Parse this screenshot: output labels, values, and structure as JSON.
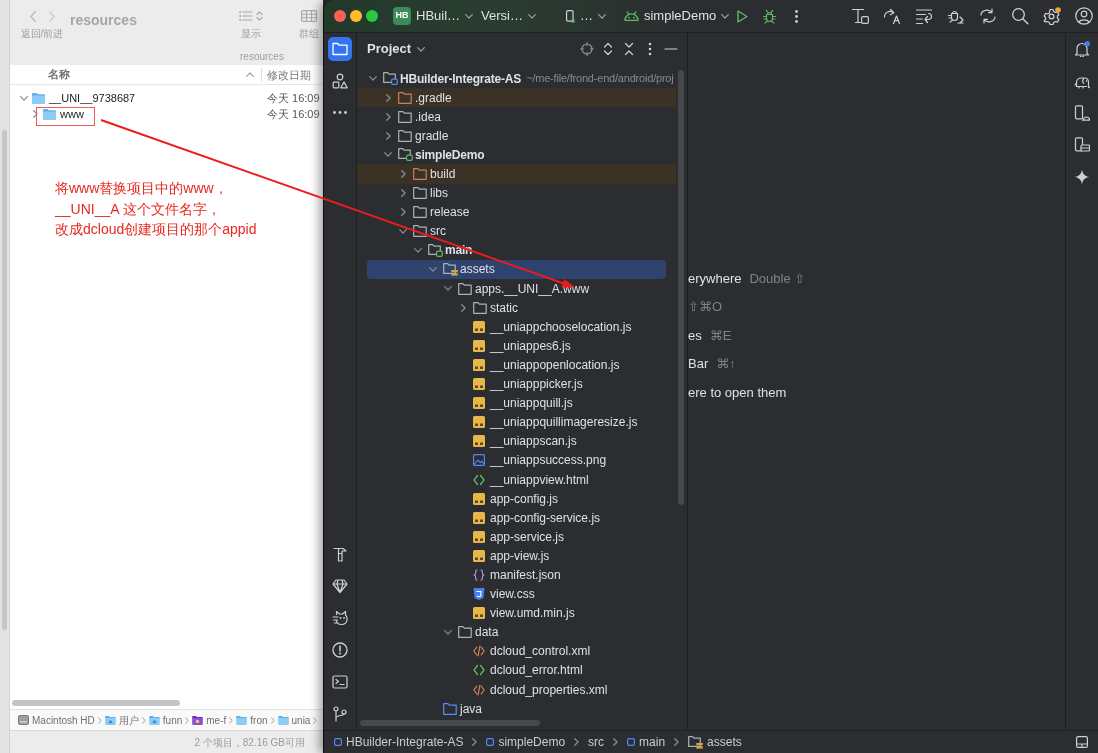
{
  "finder": {
    "title": "resources",
    "nav_label": "返回/前进",
    "view_label": "显示",
    "group_label": "群组",
    "subtitle": "resources",
    "columns": [
      "名称",
      "修改日期"
    ],
    "rows": [
      {
        "name": "__UNI__9738687",
        "modified": "今天 16:09",
        "expanded": true,
        "selected": false,
        "marked": false,
        "children": [
          {
            "name": "www",
            "modified": "今天 16:09",
            "expanded": false,
            "selected": false,
            "marked": true
          }
        ]
      }
    ],
    "path": [
      {
        "kind": "disk",
        "label": "Macintosh HD"
      },
      {
        "kind": "home",
        "label": "用户"
      },
      {
        "kind": "home",
        "label": "funn"
      },
      {
        "kind": "custom",
        "label": "me-f"
      },
      {
        "kind": "folder",
        "label": "fron"
      },
      {
        "kind": "folder",
        "label": "unia"
      }
    ],
    "status": "2 个项目，82.16 GB可用"
  },
  "annotation": {
    "lines": [
      "将www替换项目中的www，",
      "__UNI__A 这个文件名字，",
      "改成dcloud创建项目的那个appid"
    ]
  },
  "ide": {
    "toolbar": {
      "project_badge": "HB",
      "project": "HBuil…",
      "vcs": "Versi…",
      "device": "…",
      "run_config": "simpleDemo"
    },
    "left_tools": {
      "top": [
        {
          "selected": true
        },
        {
          "selected": false
        }
      ],
      "bottom": [
        {
          "selected": false
        },
        {
          "selected": false
        },
        {
          "selected": false
        },
        {
          "selected": false
        },
        {
          "selected": false
        },
        {
          "selected": false
        }
      ]
    },
    "project_panel": {
      "title": "Project",
      "tree": [
        {
          "name": "HBuilder-Integrate-AS",
          "kind": "project",
          "path": "~/me-file/frond-end/android/proj",
          "expanded": true,
          "selected": false,
          "children": [
            {
              "name": ".gradle",
              "kind": "excluded",
              "expanded": false,
              "selected": false
            },
            {
              "name": ".idea",
              "kind": "folder",
              "expanded": false,
              "selected": false
            },
            {
              "name": "gradle",
              "kind": "folder",
              "expanded": false,
              "selected": false
            },
            {
              "name": "simpleDemo",
              "kind": "module",
              "expanded": true,
              "selected": false,
              "children": [
                {
                  "name": "build",
                  "kind": "excluded",
                  "expanded": false,
                  "selected": false
                },
                {
                  "name": "libs",
                  "kind": "folder",
                  "expanded": false,
                  "selected": false
                },
                {
                  "name": "release",
                  "kind": "folder",
                  "expanded": false,
                  "selected": false
                },
                {
                  "name": "src",
                  "kind": "folder",
                  "expanded": true,
                  "selected": false,
                  "children": [
                    {
                      "name": "main",
                      "kind": "module",
                      "expanded": true,
                      "selected": false,
                      "children": [
                        {
                          "name": "assets",
                          "kind": "resources",
                          "expanded": true,
                          "selected": true,
                          "children": [
                            {
                              "name": "apps.__UNI__A.www",
                              "kind": "folder",
                              "expanded": true,
                              "selected": false,
                              "children": [
                                {
                                  "name": "static",
                                  "kind": "folder",
                                  "expanded": false,
                                  "selected": false
                                },
                                {
                                  "name": "__uniappchooselocation.js",
                                  "kind": "js",
                                  "selected": false
                                },
                                {
                                  "name": "__uniappes6.js",
                                  "kind": "js",
                                  "selected": false
                                },
                                {
                                  "name": "__uniappopenlocation.js",
                                  "kind": "js",
                                  "selected": false
                                },
                                {
                                  "name": "__uniapppicker.js",
                                  "kind": "js",
                                  "selected": false
                                },
                                {
                                  "name": "__uniappquill.js",
                                  "kind": "js",
                                  "selected": false
                                },
                                {
                                  "name": "__uniappquillimageresize.js",
                                  "kind": "js",
                                  "selected": false
                                },
                                {
                                  "name": "__uniappscan.js",
                                  "kind": "js",
                                  "selected": false
                                },
                                {
                                  "name": "__uniappsuccess.png",
                                  "kind": "png",
                                  "selected": false
                                },
                                {
                                  "name": "__uniappview.html",
                                  "kind": "html",
                                  "selected": false
                                },
                                {
                                  "name": "app-config.js",
                                  "kind": "js",
                                  "selected": false
                                },
                                {
                                  "name": "app-config-service.js",
                                  "kind": "js",
                                  "selected": false
                                },
                                {
                                  "name": "app-service.js",
                                  "kind": "js",
                                  "selected": false
                                },
                                {
                                  "name": "app-view.js",
                                  "kind": "js",
                                  "selected": false
                                },
                                {
                                  "name": "manifest.json",
                                  "kind": "json",
                                  "selected": false
                                },
                                {
                                  "name": "view.css",
                                  "kind": "css",
                                  "selected": false
                                },
                                {
                                  "name": "view.umd.min.js",
                                  "kind": "js",
                                  "selected": false
                                }
                              ]
                            },
                            {
                              "name": "data",
                              "kind": "folder",
                              "expanded": true,
                              "selected": false,
                              "children": [
                                {
                                  "name": "dcloud_control.xml",
                                  "kind": "xml",
                                  "selected": false
                                },
                                {
                                  "name": "dcloud_error.html",
                                  "kind": "html",
                                  "selected": false
                                },
                                {
                                  "name": "dcloud_properties.xml",
                                  "kind": "xml",
                                  "selected": false
                                }
                              ]
                            }
                          ]
                        },
                        {
                          "name": "java",
                          "kind": "source",
                          "selected": false
                        }
                      ]
                    }
                  ]
                }
              ]
            }
          ]
        }
      ]
    },
    "editor_hints": [
      {
        "action": "erywhere",
        "shortcut": "Double ⇧"
      },
      {
        "shortcut": "⇧⌘O"
      },
      {
        "action": "es",
        "shortcut": "⌘E"
      },
      {
        "action": "Bar",
        "shortcut": "⌘↑"
      },
      {
        "action": "ere to open them"
      }
    ],
    "breadcrumbs": [
      {
        "kind": "module",
        "label": "HBuilder-Integrate-AS"
      },
      {
        "kind": "module",
        "label": "simpleDemo"
      },
      {
        "kind": "plain",
        "label": "src"
      },
      {
        "kind": "module",
        "label": "main"
      },
      {
        "kind": "resources",
        "label": "assets"
      }
    ]
  }
}
